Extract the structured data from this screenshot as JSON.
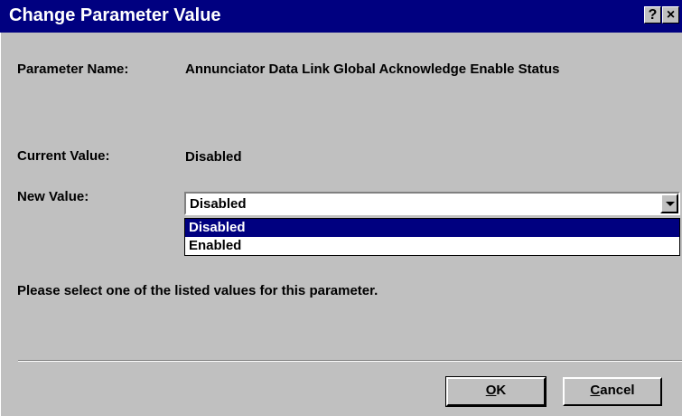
{
  "window": {
    "title": "Change Parameter Value",
    "help_button": "?",
    "close_button": "×"
  },
  "parameter_name": {
    "label": "Parameter Name:",
    "value": "Annunciator Data Link Global Acknowledge Enable Status"
  },
  "current_value": {
    "label": "Current Value:",
    "value": "Disabled"
  },
  "new_value": {
    "label": "New Value:",
    "selected": "Disabled",
    "options": [
      "Disabled",
      "Enabled"
    ]
  },
  "instruction": "Please select one of the listed values for this parameter.",
  "buttons": {
    "ok_mnemonic": "O",
    "ok_rest": "K",
    "cancel_mnemonic": "C",
    "cancel_rest": "ancel"
  }
}
